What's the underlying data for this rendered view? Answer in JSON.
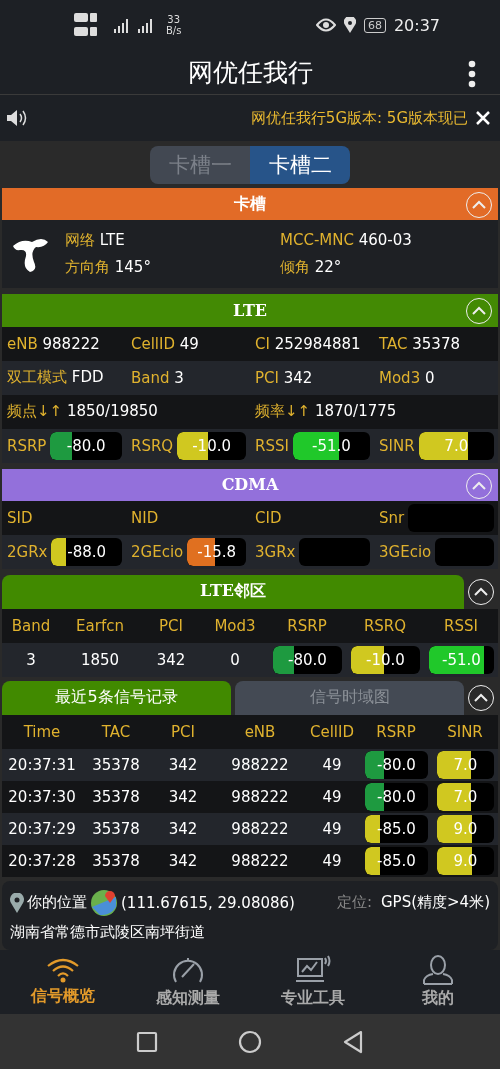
{
  "status_bar": {
    "speed": "33",
    "speed_unit": "B/s",
    "battery": "68",
    "time": "20:37"
  },
  "app_bar": {
    "title": "网优任我行"
  },
  "notice": {
    "text": "网优任我行5G版本: 5G版本现已"
  },
  "sim_tabs": [
    {
      "label": "卡槽一",
      "selected": false
    },
    {
      "label": "卡槽二",
      "selected": true
    }
  ],
  "sim_section": {
    "title": "卡槽",
    "expanded": true,
    "fields": [
      {
        "label": "网络",
        "value": "LTE"
      },
      {
        "label": "MCC-MNC",
        "value": "460-03"
      },
      {
        "label": "方向角",
        "value": "145°"
      },
      {
        "label": "倾角",
        "value": "22°"
      }
    ]
  },
  "lte_section": {
    "title": "LTE",
    "expanded": true,
    "rows": [
      [
        {
          "kind": "text",
          "label": "eNB",
          "value": "988222"
        },
        {
          "kind": "text",
          "label": "CellID",
          "value": "49"
        },
        {
          "kind": "text",
          "label": "CI",
          "value": "252984881"
        },
        {
          "kind": "text",
          "label": "TAC",
          "value": "35378"
        }
      ],
      [
        {
          "kind": "text",
          "label": "双工模式",
          "value": "FDD"
        },
        {
          "kind": "text",
          "label": "Band",
          "value": "3"
        },
        {
          "kind": "text",
          "label": "PCI",
          "value": "342"
        },
        {
          "kind": "text",
          "label": "Mod3",
          "value": "0"
        }
      ],
      [
        {
          "kind": "wide",
          "label": "频点↓↑",
          "value": "1850/19850"
        },
        "",
        {
          "kind": "wide",
          "label": "频率↓↑",
          "value": "1870/1775"
        },
        ""
      ],
      [
        {
          "kind": "meter",
          "label": "RSRP",
          "value": "-80.0",
          "level": 0.3,
          "color": "#1e9a40"
        },
        {
          "kind": "meter",
          "label": "RSRQ",
          "value": "-10.0",
          "level": 0.45,
          "color": "#d0c820"
        },
        {
          "kind": "meter",
          "label": "RSSI",
          "value": "-51.0",
          "level": 0.6,
          "color": "#20c82a"
        },
        {
          "kind": "meter",
          "label": "SINR",
          "value": "7.0",
          "level": 0.65,
          "color": "#d0c820"
        }
      ]
    ]
  },
  "cdma_section": {
    "title": "CDMA",
    "expanded": true,
    "rows": [
      [
        {
          "kind": "text",
          "label": "SID"
        },
        {
          "kind": "text",
          "label": "NID"
        },
        {
          "kind": "text",
          "label": "CID"
        },
        {
          "kind": "meter",
          "label": "Snr"
        }
      ],
      [
        {
          "kind": "meter",
          "label": "2GRx",
          "value": "-88.0",
          "level": 0.2,
          "color": "#d0c820"
        },
        {
          "kind": "meter",
          "label": "2GEcio",
          "value": "-15.8",
          "level": 0.48,
          "color": "#e07020"
        },
        {
          "kind": "meter",
          "label": "3GRx"
        },
        {
          "kind": "meter",
          "label": "3GEcio"
        }
      ]
    ]
  },
  "neighbor_section": {
    "title": "LTE邻区",
    "expanded": true,
    "columns": [
      "Band",
      "Earfcn",
      "PCI",
      "Mod3",
      "RSRP",
      "RSRQ",
      "RSSI"
    ],
    "rows": [
      [
        {
          "kind": "text",
          "text": "3"
        },
        {
          "kind": "text",
          "text": "1850"
        },
        {
          "kind": "text",
          "text": "342"
        },
        {
          "kind": "text",
          "text": "0"
        },
        {
          "kind": "meter",
          "value": "-80.0",
          "level": 0.3,
          "color": "#1e9a40"
        },
        {
          "kind": "meter",
          "value": "-10.0",
          "level": 0.48,
          "color": "#d0c820"
        },
        {
          "kind": "meter",
          "value": "-51.0",
          "level": 0.85,
          "color": "#20c82a"
        }
      ]
    ]
  },
  "records_section": {
    "expanded": true,
    "tabs": [
      {
        "label": "最近5条信号记录",
        "selected": true
      },
      {
        "label": "信号时域图",
        "selected": false
      }
    ],
    "columns": [
      "Time",
      "TAC",
      "PCI",
      "eNB",
      "CellID",
      "RSRP",
      "SINR"
    ],
    "rows": [
      [
        {
          "kind": "text",
          "text": "20:37:31"
        },
        {
          "kind": "text",
          "text": "35378"
        },
        {
          "kind": "text",
          "text": "342"
        },
        {
          "kind": "text",
          "text": "988222"
        },
        {
          "kind": "text",
          "text": "49"
        },
        {
          "kind": "meter",
          "value": "-80.0",
          "level": 0.3,
          "color": "#1e9a40"
        },
        {
          "kind": "meter",
          "value": "7.0",
          "level": 0.6,
          "color": "#d0c820"
        }
      ],
      [
        {
          "kind": "text",
          "text": "20:37:30"
        },
        {
          "kind": "text",
          "text": "35378"
        },
        {
          "kind": "text",
          "text": "342"
        },
        {
          "kind": "text",
          "text": "988222"
        },
        {
          "kind": "text",
          "text": "49"
        },
        {
          "kind": "meter",
          "value": "-80.0",
          "level": 0.3,
          "color": "#1e9a40"
        },
        {
          "kind": "meter",
          "value": "7.0",
          "level": 0.6,
          "color": "#d0c820"
        }
      ],
      [
        {
          "kind": "text",
          "text": "20:37:29"
        },
        {
          "kind": "text",
          "text": "35378"
        },
        {
          "kind": "text",
          "text": "342"
        },
        {
          "kind": "text",
          "text": "988222"
        },
        {
          "kind": "text",
          "text": "49"
        },
        {
          "kind": "meter",
          "value": "-85.0",
          "level": 0.24,
          "color": "#d0c820"
        },
        {
          "kind": "meter",
          "value": "9.0",
          "level": 0.62,
          "color": "#d0c820"
        }
      ],
      [
        {
          "kind": "text",
          "text": "20:37:28"
        },
        {
          "kind": "text",
          "text": "35378"
        },
        {
          "kind": "text",
          "text": "342"
        },
        {
          "kind": "text",
          "text": "988222"
        },
        {
          "kind": "text",
          "text": "49"
        },
        {
          "kind": "meter",
          "value": "-85.0",
          "level": 0.24,
          "color": "#d0c820"
        },
        {
          "kind": "meter",
          "value": "9.0",
          "level": 0.62,
          "color": "#d0c820"
        }
      ]
    ]
  },
  "location": {
    "label": "你的位置",
    "coords": "(111.67615, 29.08086)",
    "mode_label": "定位:",
    "mode": "GPS(精度>4米)",
    "address": "湖南省常德市武陵区南坪街道"
  },
  "bottom_nav": [
    {
      "label": "信号概览",
      "selected": true
    },
    {
      "label": "感知测量",
      "selected": false
    },
    {
      "label": "专业工具",
      "selected": false
    },
    {
      "label": "我的",
      "selected": false
    }
  ]
}
